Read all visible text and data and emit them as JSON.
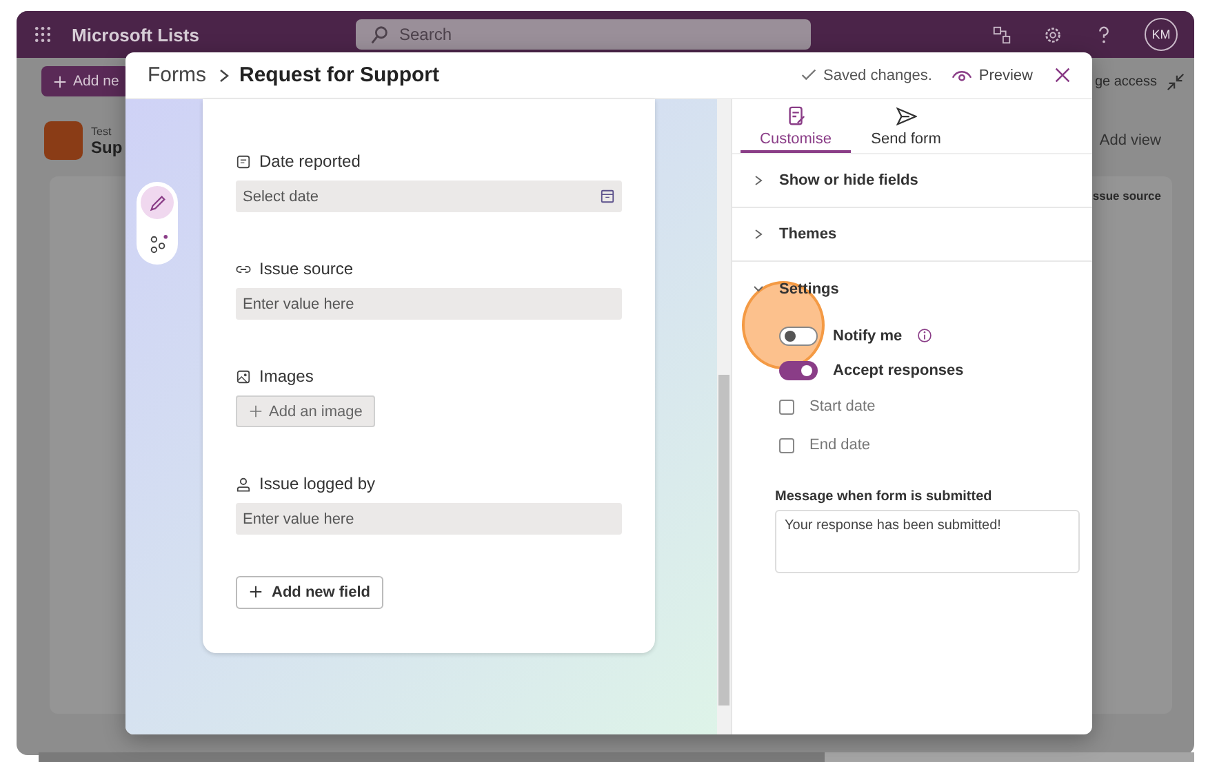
{
  "app": {
    "title": "Microsoft Lists",
    "search_placeholder": "Search",
    "avatar": "KM",
    "command": "Add ne",
    "share": "ge access",
    "list_subtitle": "Test",
    "list_title": "Sup",
    "add_view": "Add view",
    "column": "ssue source"
  },
  "dialog": {
    "breadcrumb_root": "Forms",
    "title": "Request for Support",
    "status": "Saved changes.",
    "preview": "Preview"
  },
  "tools": [
    {
      "kind": "edit",
      "selected": true
    },
    {
      "kind": "flow",
      "selected": false
    }
  ],
  "form": {
    "fields": [
      {
        "kind": "date",
        "label": "Date reported",
        "placeholder": "Select date"
      },
      {
        "kind": "link",
        "label": "Issue source",
        "placeholder": "Enter value here"
      },
      {
        "kind": "image",
        "label": "Images",
        "button": "Add an image"
      },
      {
        "kind": "person",
        "label": "Issue logged by",
        "placeholder": "Enter value here"
      }
    ],
    "add_field": "Add new field"
  },
  "panel": {
    "tabs": [
      {
        "kind": "customise",
        "label": "Customise",
        "selected": true
      },
      {
        "kind": "send",
        "label": "Send form",
        "selected": false
      }
    ],
    "sections": [
      {
        "label": "Show or hide fields",
        "expanded": false
      },
      {
        "label": "Themes",
        "expanded": false
      },
      {
        "label": "Settings",
        "expanded": true
      }
    ],
    "settings": [
      {
        "kind": "toggle",
        "label": "Notify me",
        "on": false,
        "info": true
      },
      {
        "kind": "toggle",
        "label": "Accept responses",
        "on": true
      },
      {
        "kind": "checkbox",
        "label": "Start date",
        "checked": false
      },
      {
        "kind": "checkbox",
        "label": "End date",
        "checked": false
      }
    ],
    "message": {
      "label": "Message when form is submitted",
      "value": "Your response has been submitted!"
    }
  }
}
